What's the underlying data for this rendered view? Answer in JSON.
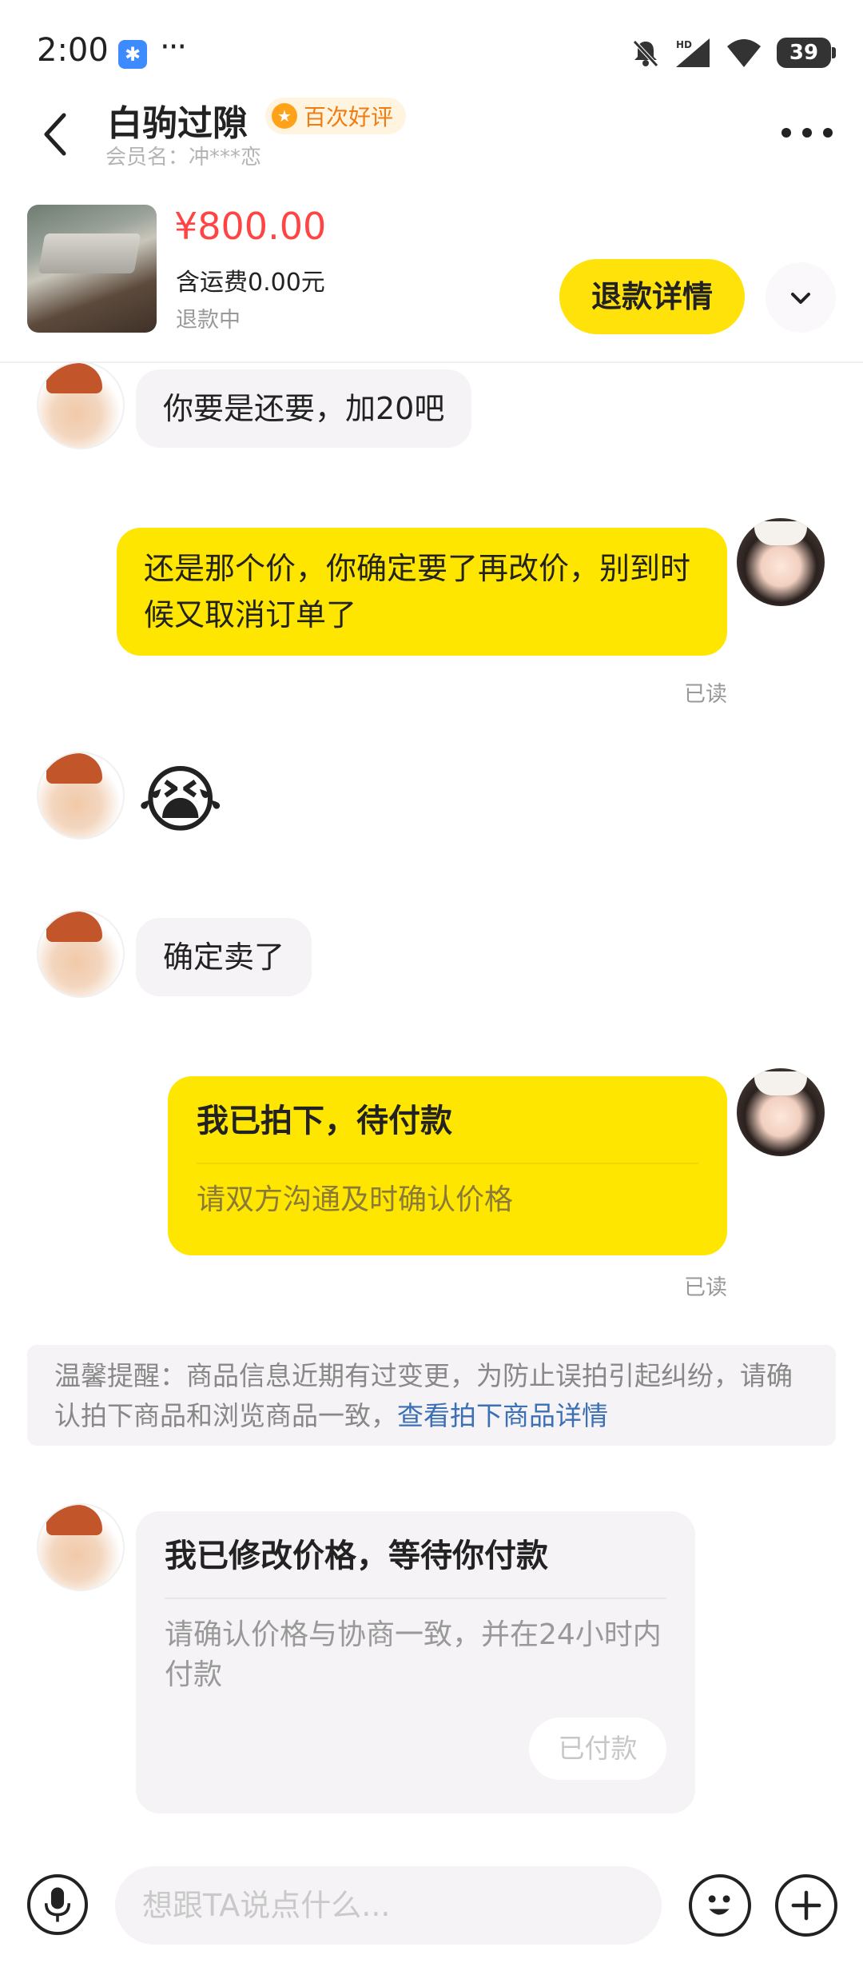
{
  "status_bar": {
    "time": "2:00",
    "app_badge": "✱",
    "more": "···",
    "battery": "39"
  },
  "header": {
    "title": "白驹过隙",
    "badge": "百次好评",
    "member": "会员名：冲***恋"
  },
  "product": {
    "price": "¥800.00",
    "shipping": "含运费0.00元",
    "status": "退款中",
    "refund_button": "退款详情"
  },
  "messages": {
    "m1": "你要是还要，加20吧",
    "m2": "还是那个价，你确定要了再改价，别到时候又取消订单了",
    "m2_read": "已读",
    "m3_emoji": "😭",
    "m4": "确定卖了",
    "m5_title": "我已拍下，待付款",
    "m5_sub": "请双方沟通及时确认价格",
    "m5_read": "已读",
    "notice_text": "温馨提醒：商品信息近期有过变更，为防止误拍引起纠纷，请确认拍下商品和浏览商品一致，",
    "notice_link": "查看拍下商品详情",
    "m6_title": "我已修改价格，等待你付款",
    "m6_sub": "请确认价格与协商一致，并在24小时内付款",
    "m6_button": "已付款"
  },
  "input_bar": {
    "placeholder": "想跟TA说点什么..."
  },
  "colors": {
    "accent_yellow": "#ffe600",
    "price_red": "#ff4444",
    "link_blue": "#3b6fb6",
    "badge_orange": "#f07d12"
  }
}
